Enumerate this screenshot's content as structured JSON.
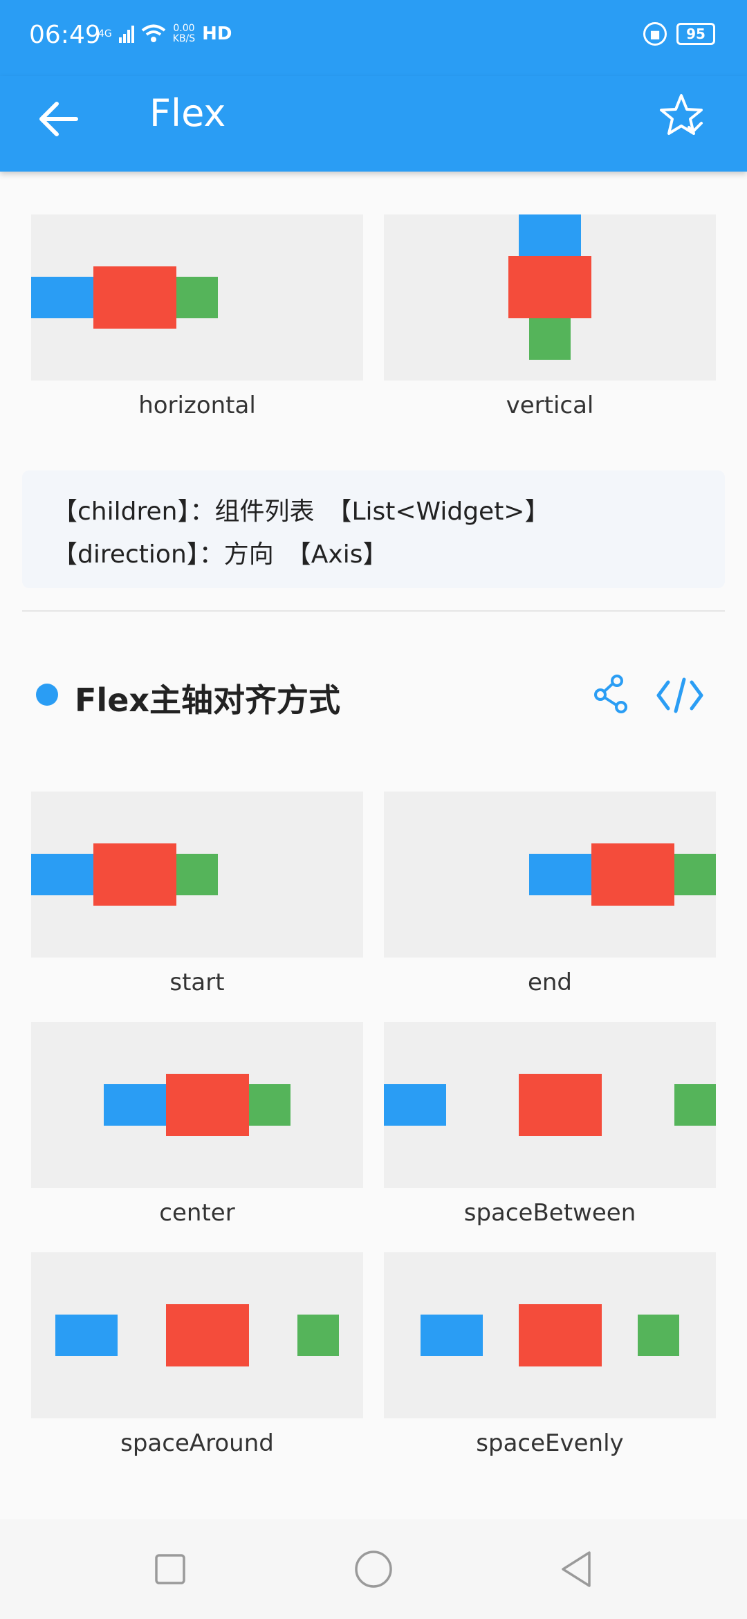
{
  "status_bar": {
    "time": "06:49",
    "network_type": "4G",
    "data_rate_value": "0.00",
    "data_rate_unit": "KB/S",
    "hd_label": "HD",
    "battery_level": "95"
  },
  "app_bar": {
    "title": "Flex",
    "back_icon": "arrow-left-icon",
    "favorite_icon": "star-check-icon"
  },
  "direction_demos": [
    {
      "label": "horizontal"
    },
    {
      "label": "vertical"
    }
  ],
  "params": [
    "【children】：组件列表　【List<Widget>】",
    "【direction】：方向　【Axis】"
  ],
  "section": {
    "title": "Flex主轴对齐方式",
    "share_icon": "share-icon",
    "code_icon": "code-icon"
  },
  "alignment_demos": [
    {
      "label": "start"
    },
    {
      "label": "end"
    },
    {
      "label": "center"
    },
    {
      "label": "spaceBetween"
    },
    {
      "label": "spaceAround"
    },
    {
      "label": "spaceEvenly"
    }
  ],
  "nav_bar": {
    "recents_icon": "square-icon",
    "home_icon": "circle-icon",
    "back_icon": "triangle-back-icon"
  },
  "colors": {
    "primary": "#2a9df4",
    "red_box": "#f44c3b",
    "green_box": "#55b45a",
    "tile_bg": "#efefef"
  }
}
